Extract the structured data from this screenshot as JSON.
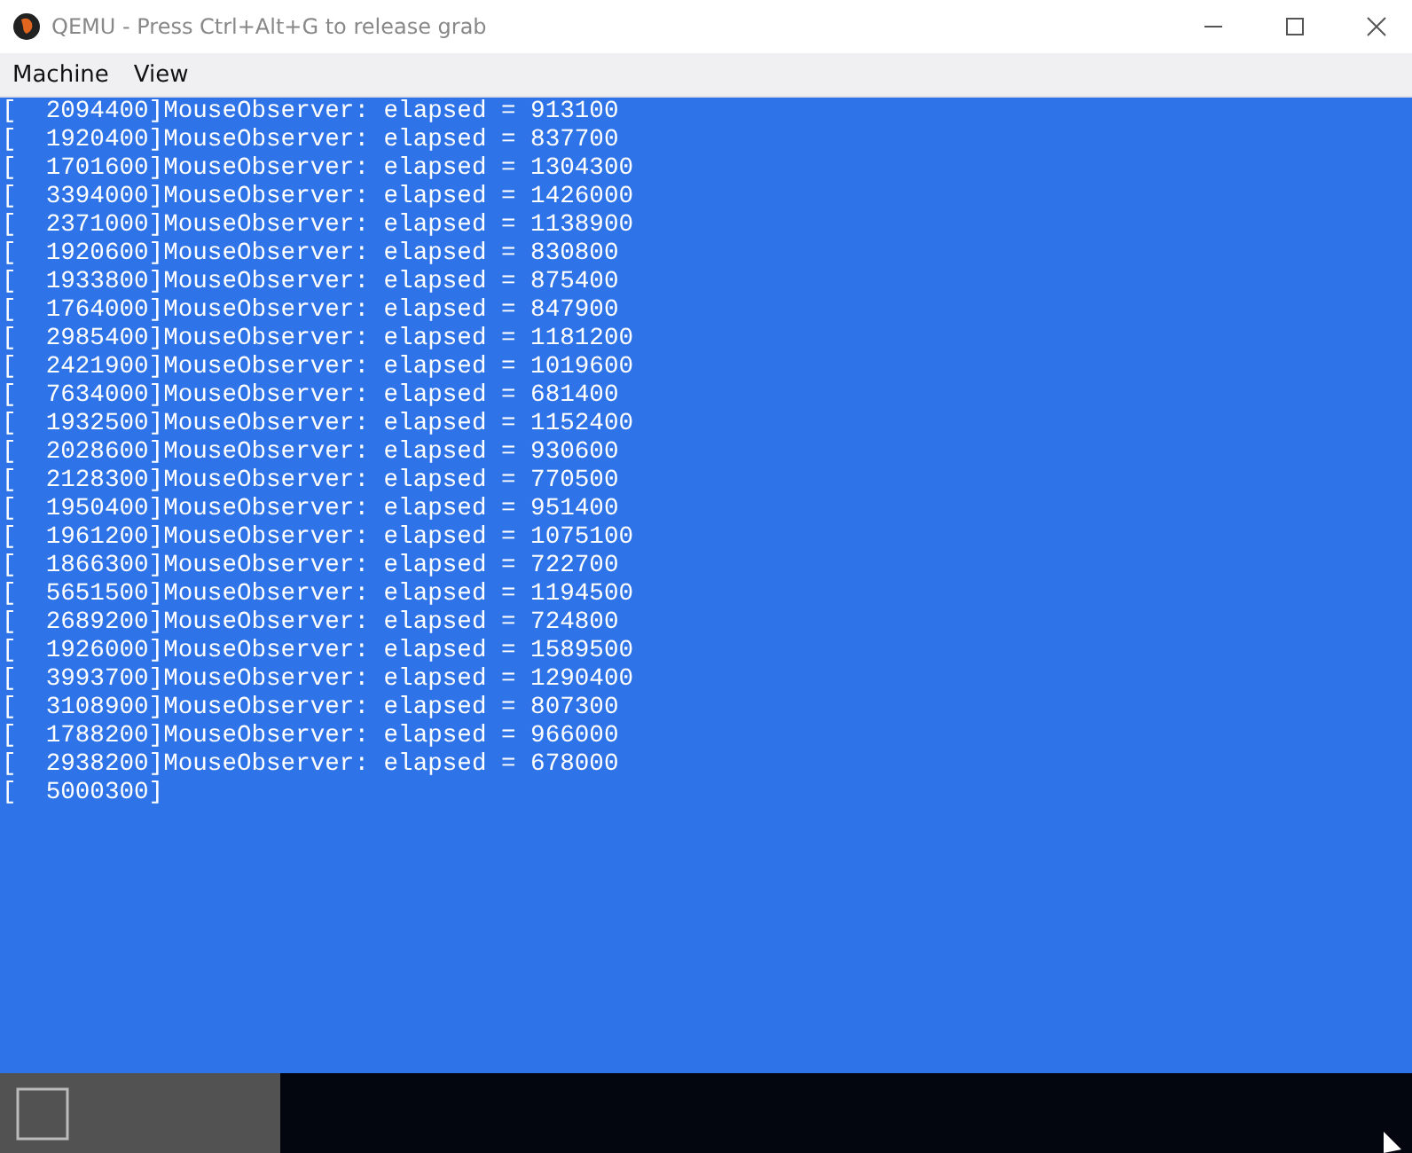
{
  "window": {
    "title": "QEMU - Press Ctrl+Alt+G to release grab"
  },
  "menu": [
    "Machine",
    "View"
  ],
  "console_lines": [
    "[  2094400]MouseObserver: elapsed = 913100",
    "[  1920400]MouseObserver: elapsed = 837700",
    "[  1701600]MouseObserver: elapsed = 1304300",
    "[  3394000]MouseObserver: elapsed = 1426000",
    "[  2371000]MouseObserver: elapsed = 1138900",
    "[  1920600]MouseObserver: elapsed = 830800",
    "[  1933800]MouseObserver: elapsed = 875400",
    "[  1764000]MouseObserver: elapsed = 847900",
    "[  2985400]MouseObserver: elapsed = 1181200",
    "[  2421900]MouseObserver: elapsed = 1019600",
    "[  7634000]MouseObserver: elapsed = 681400",
    "[  1932500]MouseObserver: elapsed = 1152400",
    "[  2028600]MouseObserver: elapsed = 930600",
    "[  2128300]MouseObserver: elapsed = 770500",
    "[  1950400]MouseObserver: elapsed = 951400",
    "[  1961200]MouseObserver: elapsed = 1075100",
    "[  1866300]MouseObserver: elapsed = 722700",
    "[  5651500]MouseObserver: elapsed = 1194500",
    "[  2689200]MouseObserver: elapsed = 724800",
    "[  1926000]MouseObserver: elapsed = 1589500",
    "[  3993700]MouseObserver: elapsed = 1290400",
    "[  3108900]MouseObserver: elapsed = 807300",
    "[  1788200]MouseObserver: elapsed = 966000",
    "[  2938200]MouseObserver: elapsed = 678000",
    "[  5000300]"
  ]
}
